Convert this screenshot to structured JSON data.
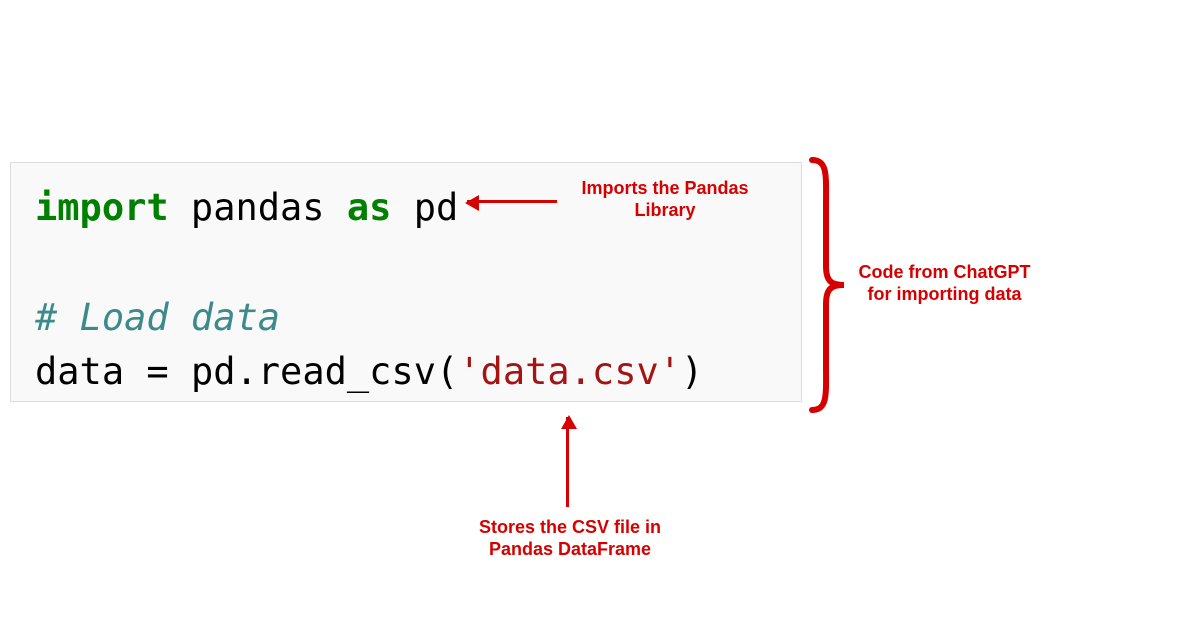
{
  "code": {
    "line1": {
      "import": "import",
      "pandas": " pandas ",
      "as": "as",
      "pd": " pd"
    },
    "line3": "# Load data",
    "line4": {
      "data": "data ",
      "eq": "=",
      "expr": " pd.read_csv(",
      "str": "'data.csv'",
      "close": ")"
    }
  },
  "annotations": {
    "imports": "Imports the Pandas\nLibrary",
    "stores": "Stores the CSV file in\nPandas DataFrame",
    "chatgpt": "Code from ChatGPT\nfor importing data"
  }
}
